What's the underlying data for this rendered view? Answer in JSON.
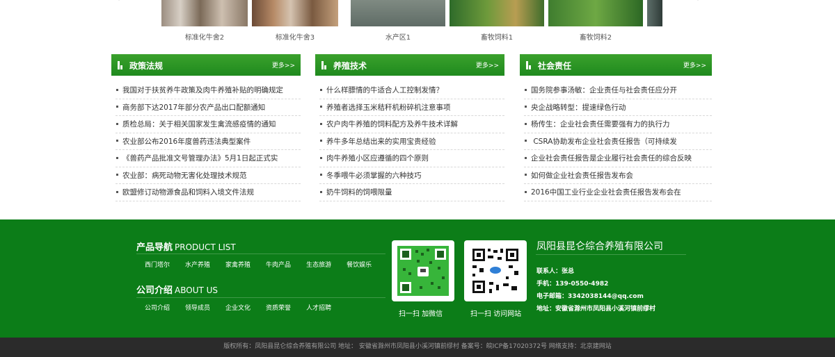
{
  "gallery": {
    "items": [
      {
        "caption": "标准化牛舍2"
      },
      {
        "caption": "标准化牛舍3"
      },
      {
        "caption": "水产区1"
      },
      {
        "caption": "畜牧饲料1"
      },
      {
        "caption": "畜牧饲料2"
      }
    ],
    "prev_icon": "chevron-left-icon",
    "next_icon": "chevron-right-icon"
  },
  "columns": [
    {
      "title": "政策法规",
      "more": "更多>>",
      "items": [
        "我国对于扶贫养牛政策及肉牛养殖补贴的明确规定",
        "商务部下达2017年部分农产品出口配额通知",
        "质检总局：关于相关国家发生禽流感疫情的通知",
        "农业部公布2016年度兽药违法典型案件",
        "《兽药产品批准文号管理办法》5月1日起正式实",
        "农业部：病死动物无害化处理技术规范",
        "欧盟修订动物源食品和饲料入境文件法规"
      ]
    },
    {
      "title": "养殖技术",
      "more": "更多>>",
      "items": [
        "什么样膘情的牛适合人工控制发情？",
        "养殖者选择玉米秸秆机粉碎机注意事项",
        "农户肉牛养殖的饲料配方及养牛技术详解",
        "养牛多年总结出来的实用宝贵经验",
        "肉牛养殖小区应遵循的四个原则",
        "冬季喂牛必须掌握的六种技巧",
        "奶牛饲料的饲喂限量"
      ]
    },
    {
      "title": "社会责任",
      "more": "更多>>",
      "items": [
        "国务院参事汤敏：企业责任与社会责任应分开",
        "央企战略转型：提速绿色行动",
        "杨传生：企业社会责任需要强有力的执行力",
        " CSRA协助发布企业社会责任报告（可持续发",
        "企业社会责任报告是企业履行社会责任的综合反映",
        "如何做企业社会责任报告发布会",
        "2016中国工业行业企业社会责任报告发布会在"
      ]
    }
  ],
  "footer": {
    "product_nav": {
      "title": "产品导航",
      "title_en": "PRODUCT LIST",
      "links": [
        "西门塔尔",
        "水产养殖",
        "家禽养殖",
        "牛肉产品",
        "生态旅游",
        "餐饮娱乐"
      ]
    },
    "company_intro": {
      "title": "公司介绍",
      "title_en": "ABOUT US",
      "links": [
        "公司介绍",
        "领导成员",
        "企业文化",
        "资质荣誉",
        "人才招聘"
      ]
    },
    "qr_wechat_caption": "扫一扫 加微信",
    "qr_site_caption": "扫一扫 访问网站",
    "company_name": "凤阳县昆仑综合养殖有限公司",
    "contact": {
      "person": "联系人：张总",
      "phone": "手机：139-0550-4982",
      "email": "电子邮箱：3342038144@qq.com",
      "address": "地址：安徽省滁州市凤阳县小溪河镇前缪村"
    }
  },
  "copyright": "版权所有：凤阳县昆仑综合养殖有限公司 地址： 安徽省滁州市凤阳县小溪河镇前缪村 备案号：皖ICP备17020372号 网络支持：北京建网站",
  "colors": {
    "accent_green": "#1f8a1e",
    "footer_green": "#0c7d18",
    "copyright_bg": "#2b2b2b"
  }
}
